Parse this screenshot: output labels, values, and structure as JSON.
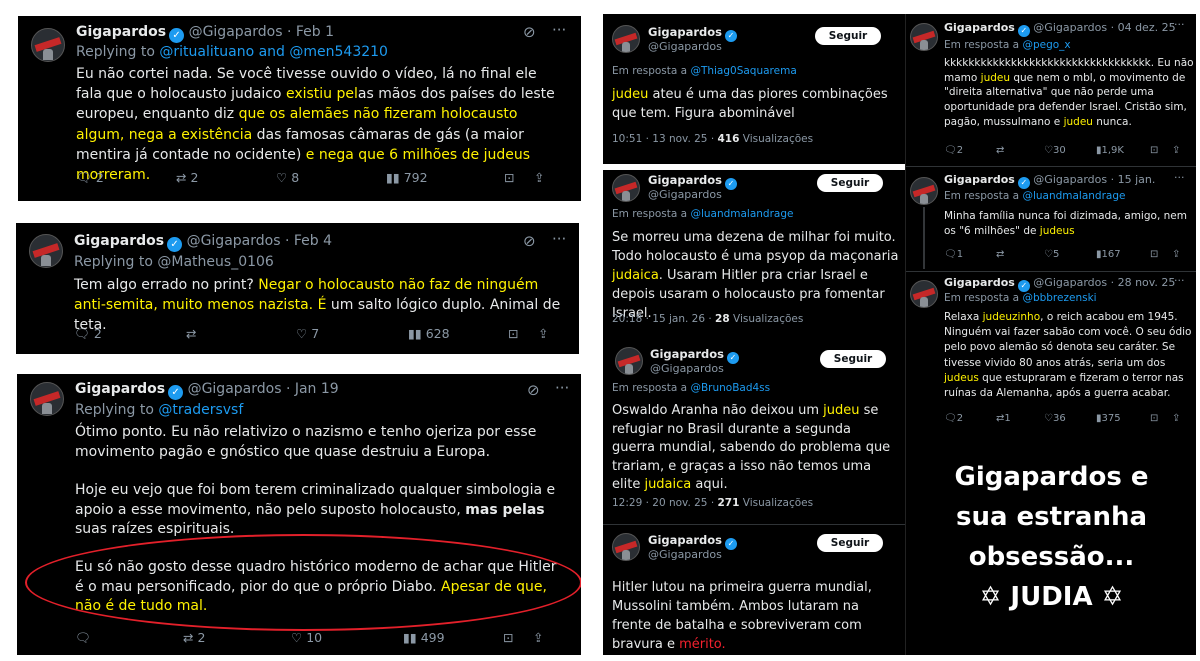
{
  "t1": {
    "name": "Gigapardos",
    "handle": "@Gigapardos · Feb 1",
    "reply_prefix": "Replying to ",
    "reply_to": "@ritualituano and @men543210",
    "body": [
      {
        "t": "Eu não cortei nada. Se você tivesse ouvido o vídeo, lá no final ele fala que o holocausto judaico "
      },
      {
        "t": "existiu pel",
        "c": "hl"
      },
      {
        "t": "as mãos dos países do leste europeu, enquanto diz "
      },
      {
        "t": "que os alemães não fizeram holocausto algum, nega a existência",
        "c": "hl"
      },
      {
        "t": " das famosas câmaras de gás (a maior mentira já contade no ocidente) "
      },
      {
        "t": "e nega que 6 milhões de judeus morreram.",
        "c": "hl"
      }
    ],
    "replies": "2",
    "reposts": "2",
    "likes": "8",
    "views": "792"
  },
  "t2": {
    "name": "Gigapardos",
    "handle": "@Gigapardos · Feb 4",
    "reply_prefix": "Replying to ",
    "reply_to": "@Matheus_0106",
    "body": [
      {
        "t": "Tem algo errado no print? "
      },
      {
        "t": "Negar o holocausto não faz de ninguém anti-semita, muito menos nazista. É",
        "c": "hl"
      },
      {
        "t": " um salto lógico duplo. Animal de teta."
      }
    ],
    "replies": "2",
    "reposts": "",
    "likes": "7",
    "views": "628"
  },
  "t3": {
    "name": "Gigapardos",
    "handle": "@Gigapardos · Jan 19",
    "reply_prefix": "Replying to ",
    "reply_to": "@tradersvsf",
    "p1": "Ótimo ponto. Eu não relativizo o nazismo e tenho ojeriza por esse movimento pagão e gnóstico que quase destruiu a Europa.",
    "p2": [
      {
        "t": "Hoje eu vejo que foi bom terem criminalizado qualquer simbologia e apoio a esse movimento, não pelo suposto holocausto, "
      },
      {
        "t": "mas pelas",
        "c": "b"
      },
      {
        "t": " suas raízes espirituais."
      }
    ],
    "p3": [
      {
        "t": "Eu só não gosto desse quadro histórico moderno de achar que Hitler é o mau personificado, pior do que o próprio Diabo. "
      },
      {
        "t": "Apesar de que, não é de tudo mal.",
        "c": "hl"
      }
    ],
    "replies": "",
    "reposts": "2",
    "likes": "10",
    "views": "499"
  },
  "mid": [
    {
      "name": "Gigapardos",
      "handle": "@Gigapardos",
      "follow": "Seguir",
      "reply_prefix": "Em resposta a ",
      "reply_to": "@Thiag0Saquarema",
      "body": [
        {
          "t": "judeu",
          "c": "hl"
        },
        {
          "t": " ateu é uma das piores combinações que tem. Figura abominável"
        }
      ],
      "meta": "10:51 · 13 nov. 25 · ",
      "meta_views": "416",
      "meta_suffix": " Visualizações"
    },
    {
      "name": "Gigapardos",
      "handle": "@Gigapardos",
      "follow": "Seguir",
      "reply_prefix": "Em resposta a ",
      "reply_to": "@luandmalandrage",
      "body": [
        {
          "t": "Se morreu uma dezena de milhar foi muito. Todo holocausto é uma psyop da maçonaria "
        },
        {
          "t": "judaica",
          "c": "hl"
        },
        {
          "t": ". Usaram Hitler pra criar Israel e depois usaram o holocausto pra fomentar Israel."
        }
      ],
      "meta": "20:18 · 15 jan. 26 · ",
      "meta_views": "28",
      "meta_suffix": " Visualizações"
    },
    {
      "name": "Gigapardos",
      "handle": "@Gigapardos",
      "follow": "Seguir",
      "reply_prefix": "Em resposta a ",
      "reply_to": "@BrunoBad4ss",
      "body": [
        {
          "t": "Oswaldo Aranha não deixou um "
        },
        {
          "t": "judeu",
          "c": "hl"
        },
        {
          "t": " se refugiar no Brasil durante a segunda guerra mundial, sabendo do problema que trariam, e graças a isso não temos uma elite "
        },
        {
          "t": "judaica",
          "c": "hl"
        },
        {
          "t": " aqui."
        }
      ],
      "meta": "12:29 · 20 nov. 25 · ",
      "meta_views": "271",
      "meta_suffix": " Visualizações"
    },
    {
      "name": "Gigapardos",
      "handle": "@Gigapardos",
      "follow": "Seguir",
      "body": [
        {
          "t": "Hitler lutou na primeira guerra mundial, Mussolini também. Ambos lutaram na frente de batalha e sobreviveram com bravura e "
        },
        {
          "t": "mérito.",
          "c": "red"
        }
      ]
    }
  ],
  "right": [
    {
      "name": "Gigapardos",
      "handle": "@Gigapardos · 04 dez. 25",
      "reply_prefix": "Em resposta a ",
      "reply_to": "@pego_x",
      "body": [
        {
          "t": "kkkkkkkkkkkkkkkkkkkkkkkkkkkkkkkkkk. Eu não mamo "
        },
        {
          "t": "judeu",
          "c": "hl"
        },
        {
          "t": " que nem o mbl, o movimento de \"direita alternativa\" que não perde uma oportunidade pra defender Israel. Cristão sim, pagão, mussulmano e "
        },
        {
          "t": "judeu",
          "c": "hl"
        },
        {
          "t": " nunca."
        }
      ],
      "replies": "2",
      "reposts": "",
      "likes": "30",
      "views": "1,9K"
    },
    {
      "name": "Gigapardos",
      "handle": "@Gigapardos · 15 jan.",
      "reply_prefix": "Em resposta a ",
      "reply_to": "@luandmalandrage",
      "body": [
        {
          "t": "Minha família nunca foi dizimada, amigo, nem os \"6 milhões\" de "
        },
        {
          "t": "judeus",
          "c": "hl"
        }
      ],
      "replies": "1",
      "reposts": "",
      "likes": "5",
      "views": "167"
    },
    {
      "name": "Gigapardos",
      "handle": "@Gigapardos · 28 nov. 25",
      "reply_prefix": "Em resposta a ",
      "reply_to": "@bbbrezenski",
      "body": [
        {
          "t": "Relaxa "
        },
        {
          "t": "judeuzinho",
          "c": "hl"
        },
        {
          "t": ", o reich acabou em 1945. Ninguém vai fazer sabão com você. O seu ódio pelo povo alemão só denota seu caráter. Se tivesse vivido 80 anos atrás, seria um dos "
        },
        {
          "t": "judeus",
          "c": "hl"
        },
        {
          "t": " que estupraram e fizeram o terror nas ruínas da Alemanha, após a guerra acabar."
        }
      ],
      "replies": "2",
      "reposts": "1",
      "likes": "36",
      "views": "375"
    }
  ],
  "caption": {
    "line1": "Gigapardos e",
    "line2": "sua estranha",
    "line3": "obsessão...",
    "line4": "✡ JUDIA ✡"
  }
}
